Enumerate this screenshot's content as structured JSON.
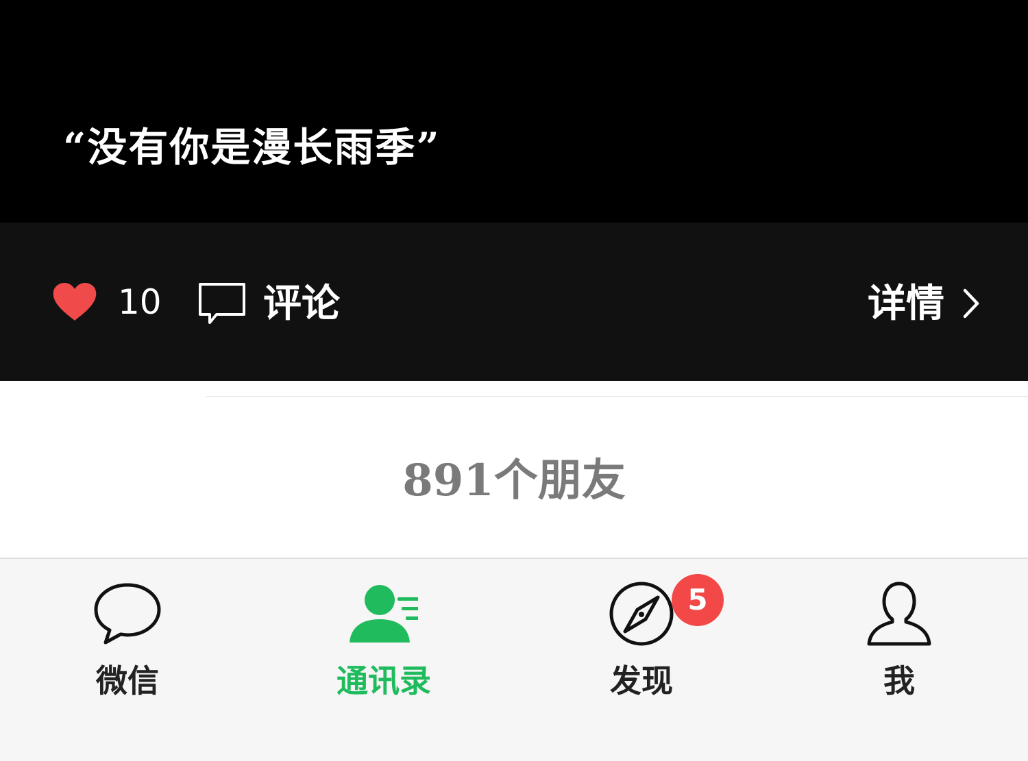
{
  "post": {
    "quote": "“没有你是漫长雨季”"
  },
  "actions": {
    "like_count": "10",
    "comment_label": "评论",
    "details_label": "详情",
    "like_color": "#f04a4a"
  },
  "contacts": {
    "friend_count_text": "891个朋友"
  },
  "tabbar": {
    "active_color": "#1fbb5c",
    "badge_color": "#f24848",
    "tabs": [
      {
        "label": "微信",
        "icon": "chat-bubble-icon"
      },
      {
        "label": "通讯录",
        "icon": "contacts-icon"
      },
      {
        "label": "发现",
        "icon": "compass-icon",
        "badge": "5"
      },
      {
        "label": "我",
        "icon": "person-icon"
      }
    ]
  }
}
